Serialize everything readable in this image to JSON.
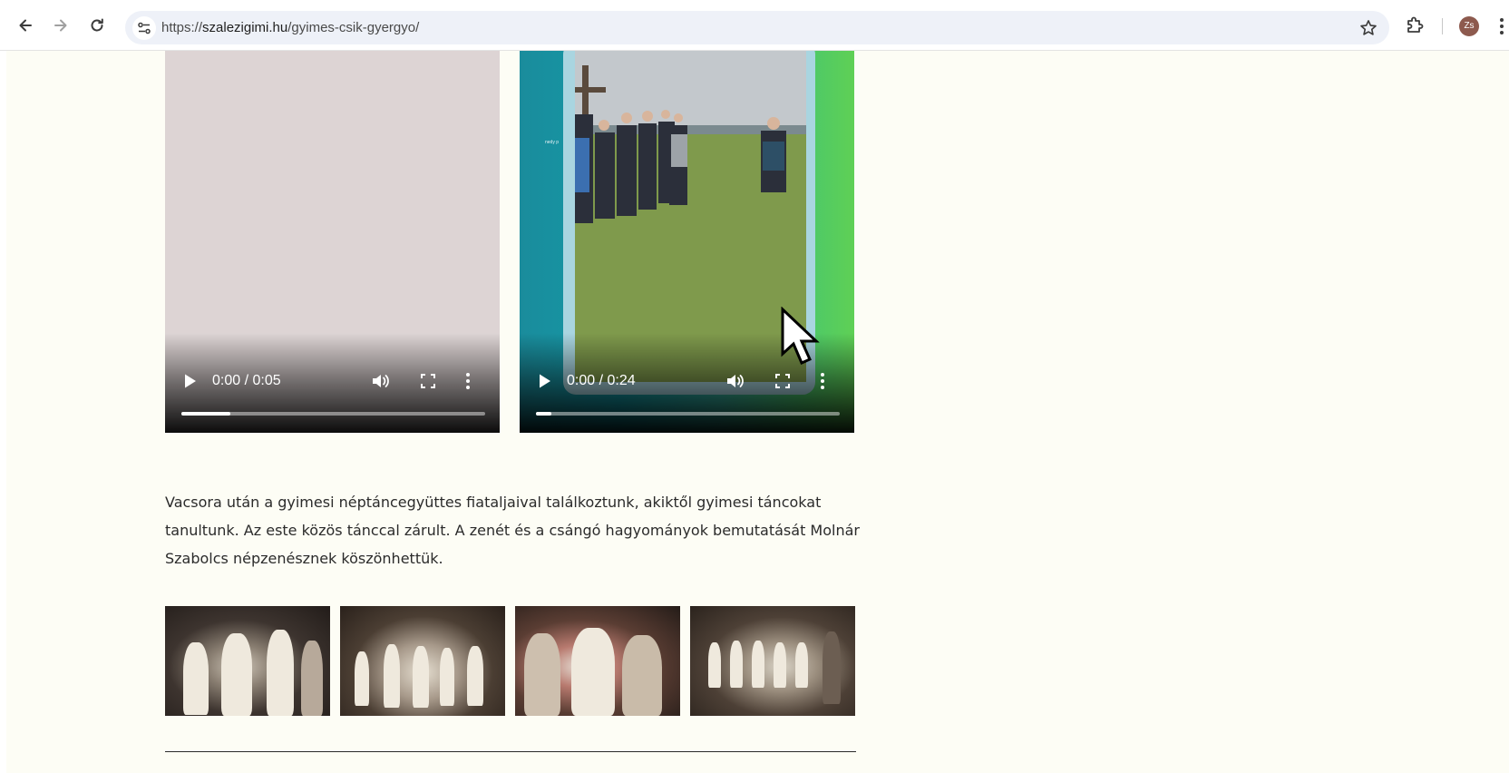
{
  "browser": {
    "url_prefix": "https://",
    "url_host": "szalezigimi.hu",
    "url_path": "/gyimes-csik-gyergyo/",
    "profile_initials": "Zs"
  },
  "videos": [
    {
      "time": "0:00 / 0:05",
      "progress": 0.16,
      "overlay_text": ""
    },
    {
      "time": "0:00 / 0:24",
      "progress": 0.05,
      "overlay_text": "nedy p"
    }
  ],
  "article": {
    "paragraph": "Vacsora után a gyimesi néptáncegyüttes fiataljaival találkoztunk, akiktől gyimesi táncokat tanultunk. Az este közös tánccal zárult. A zenét és a csángó hagyományok bemutatását Molnár Szabolcs népzenésznek köszönhettük."
  },
  "gallery": {
    "images": [
      "dance-photo-1",
      "dance-photo-2",
      "dance-photo-3",
      "dance-photo-4"
    ]
  },
  "colors": {
    "page_bg": "#fdfdf5",
    "text": "#2b2b2b"
  }
}
